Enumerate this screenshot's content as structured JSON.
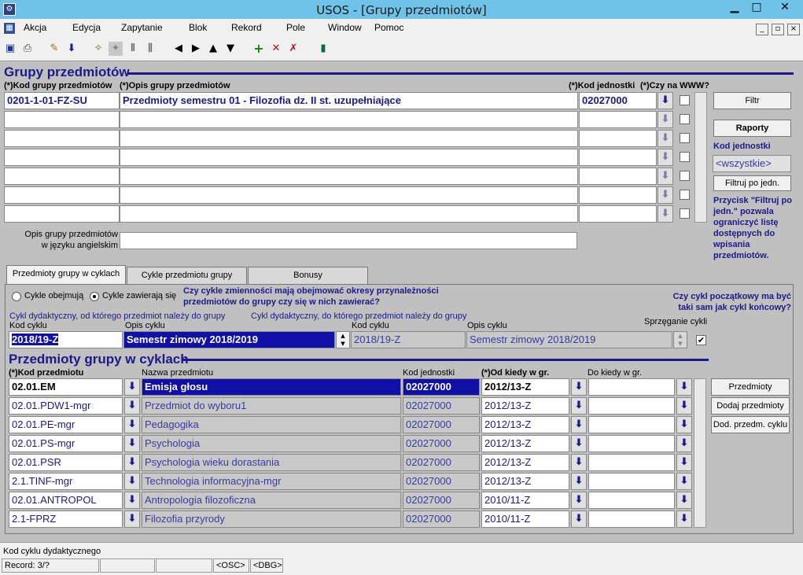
{
  "window": {
    "title": "USOS - [Grupy przedmiotów]",
    "minimize": "▁",
    "maximize": "□",
    "close": "✕"
  },
  "menu": {
    "items": [
      "Akcja",
      "Edycja",
      "Zapytanie",
      "Blok",
      "Rekord",
      "Pole",
      "Window",
      "Pomoc"
    ]
  },
  "toolbar": {
    "icons": [
      "save-icon",
      "print-icon",
      "edit-icon",
      "download-icon",
      "query-icon",
      "query2-icon",
      "bar1-icon",
      "bar2-icon",
      "prev-icon",
      "next-icon",
      "up-icon",
      "down-icon",
      "add-icon",
      "delete-icon",
      "clear-icon",
      "exit-icon"
    ]
  },
  "groups": {
    "title": "Grupy przedmiotów",
    "col_code": "(*)Kod grupy przedmiotów",
    "col_desc": "(*)Opis grupy przedmiotów",
    "col_unit": "(*)Kod jednostki",
    "col_www": "(*)Czy na WWW?",
    "rows": [
      {
        "code": "0201-1-01-FZ-SU",
        "desc": "Przedmioty semestru 01 - Filozofia dz. II st. uzupełniające",
        "unit": "02027000"
      },
      {
        "code": "",
        "desc": "",
        "unit": ""
      },
      {
        "code": "",
        "desc": "",
        "unit": ""
      },
      {
        "code": "",
        "desc": "",
        "unit": ""
      },
      {
        "code": "",
        "desc": "",
        "unit": ""
      },
      {
        "code": "",
        "desc": "",
        "unit": ""
      },
      {
        "code": "",
        "desc": "",
        "unit": ""
      }
    ],
    "eng_label_1": "Opis grupy przedmiotów",
    "eng_label_2": "w języku angielskim",
    "eng_value": ""
  },
  "side": {
    "filter_btn": "Filtr",
    "reports_btn": "Raporty",
    "unit_label": "Kod jednostki",
    "unit_value": "<wszystkie>",
    "filter_unit_btn": "Filtruj po jedn.",
    "note": "Przycisk \"Filtruj po jedn.\" pozwala ograniczyć listę dostępnych do wpisania przedmiotów."
  },
  "tabs": [
    "Przedmioty grupy w cyklach",
    "Cykle przedmiotu grupy",
    "Bonusy"
  ],
  "cycles": {
    "radio1": "Cykle obejmują",
    "radio2": "Cykle zawierają się",
    "question": "Czy cykle zmienności mają obejmować okresy przynależności przedmiotów do grupy czy się w nich zawierać?",
    "question2": "Czy cykl początkowy ma być taki sam jak cykl końcowy?",
    "from_label": "Cykl dydaktyczny, od którego przedmiot należy do grupy",
    "to_label": "Cykl dydaktyczny, do którego przedmiot należy do grupy",
    "code_label": "Kod cyklu",
    "desc_label": "Opis cyklu",
    "link_label": "Sprzęganie cykli",
    "from_code": "2018/19-Z",
    "from_desc": "Semestr zimowy 2018/2019",
    "to_code": "2018/19-Z",
    "to_desc": "Semestr zimowy 2018/2019",
    "link_checked": "✔"
  },
  "subjects": {
    "title": "Przedmioty grupy w cyklach",
    "col_code": "(*)Kod przedmiotu",
    "col_name": "Nazwa przedmiotu",
    "col_unit": "Kod jednostki",
    "col_from": "(*)Od kiedy w gr.",
    "col_to": "Do kiedy w gr.",
    "rows": [
      {
        "code": "02.01.EM",
        "name": "Emisja głosu",
        "unit": "02027000",
        "from": "2012/13-Z",
        "to": ""
      },
      {
        "code": "02.01.PDW1-mgr",
        "name": "Przedmiot do wyboru1",
        "unit": "02027000",
        "from": "2012/13-Z",
        "to": ""
      },
      {
        "code": "02.01.PE-mgr",
        "name": "Pedagogika",
        "unit": "02027000",
        "from": "2012/13-Z",
        "to": ""
      },
      {
        "code": "02.01.PS-mgr",
        "name": "Psychologia",
        "unit": "02027000",
        "from": "2012/13-Z",
        "to": ""
      },
      {
        "code": "02.01.PSR",
        "name": "Psychologia wieku dorastania",
        "unit": "02027000",
        "from": "2012/13-Z",
        "to": ""
      },
      {
        "code": "2.1.TINF-mgr",
        "name": "Technologia informacyjna-mgr",
        "unit": "02027000",
        "from": "2012/13-Z",
        "to": ""
      },
      {
        "code": "02.01.ANTROPOL",
        "name": "Antropologia filozoficzna",
        "unit": "02027000",
        "from": "2010/11-Z",
        "to": ""
      },
      {
        "code": "2.1-FPRZ",
        "name": "Filozofia przyrody",
        "unit": "02027000",
        "from": "2010/11-Z",
        "to": ""
      }
    ],
    "btn_subjects": "Przedmioty",
    "btn_add": "Dodaj przedmioty",
    "btn_add_cycle": "Dod. przedm. cyklu"
  },
  "status": {
    "hint": "Kod cyklu dydaktycznego",
    "record": "Record: 3/?",
    "osc": "<OSC>",
    "dbg": "<DBG>"
  },
  "lov_glyph": "⬇"
}
